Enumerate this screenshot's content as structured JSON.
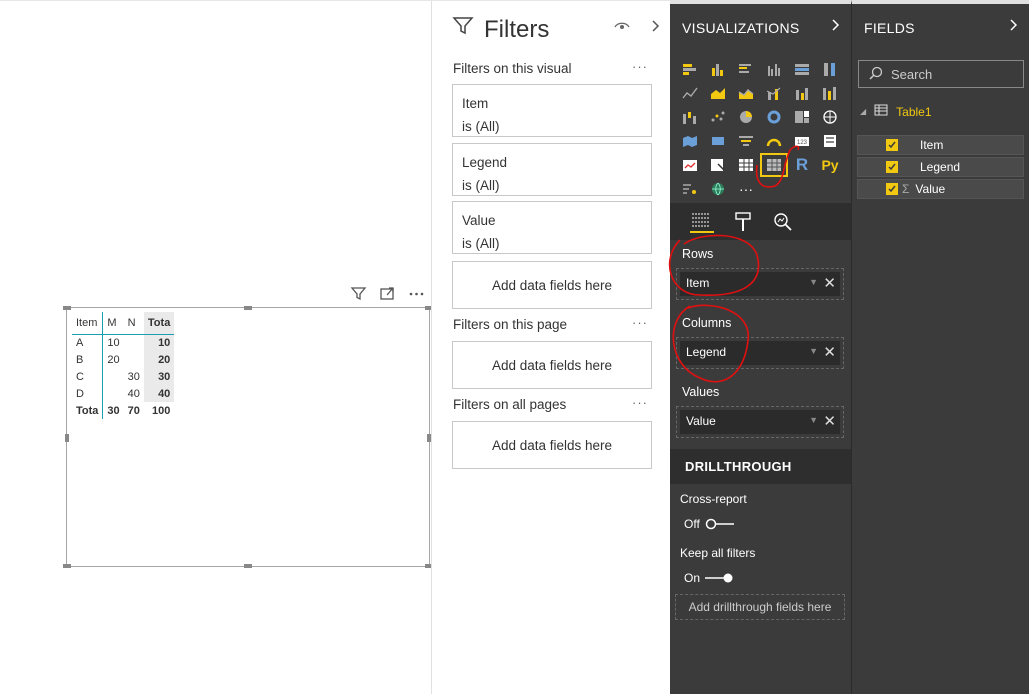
{
  "filters_pane": {
    "title": "Filters",
    "section_visual": "Filters on this visual",
    "section_page": "Filters on this page",
    "section_all": "Filters on all pages",
    "more": "···",
    "cards": [
      {
        "field": "Item",
        "state": "is (All)"
      },
      {
        "field": "Legend",
        "state": "is (All)"
      },
      {
        "field": "Value",
        "state": "is (All)"
      }
    ],
    "add_visual": "Add data fields here",
    "add_page": "Add data fields here",
    "add_all": "Add data fields here"
  },
  "matrix": {
    "headers": [
      "Item",
      "M",
      "N",
      "Tota"
    ],
    "rows": [
      [
        "A",
        "10",
        "",
        "10"
      ],
      [
        "B",
        "20",
        "",
        "20"
      ],
      [
        "C",
        "",
        "30",
        "30"
      ],
      [
        "D",
        "",
        "40",
        "40"
      ],
      [
        "Tota",
        "30",
        "70",
        "100"
      ]
    ]
  },
  "visualizations": {
    "title": "VISUALIZATIONS",
    "chevron": "›",
    "wells": {
      "rows_label": "Rows",
      "rows_value": "Item",
      "columns_label": "Columns",
      "columns_value": "Legend",
      "values_label": "Values",
      "values_value": "Value"
    },
    "drillthrough": {
      "title": "DRILLTHROUGH",
      "cross_report": "Cross-report",
      "cross_state": "Off",
      "keep_filters": "Keep all filters",
      "keep_state": "On",
      "add_fields": "Add drillthrough fields here"
    },
    "r_label": "R",
    "py_label": "Py",
    "more": "···"
  },
  "fields": {
    "title": "FIELDS",
    "chevron": "›",
    "search_placeholder": "Search",
    "table": "Table1",
    "items": [
      {
        "name": "Item",
        "checked": true
      },
      {
        "name": "Legend",
        "checked": true
      },
      {
        "name": "Value",
        "checked": true,
        "sigma": "Σ"
      }
    ]
  },
  "colors": {
    "accent_yellow": "#f2c811",
    "pane_bg": "#3b3b3b",
    "matrix_accent": "#1a9fb0",
    "annotation_red": "#e01010"
  }
}
